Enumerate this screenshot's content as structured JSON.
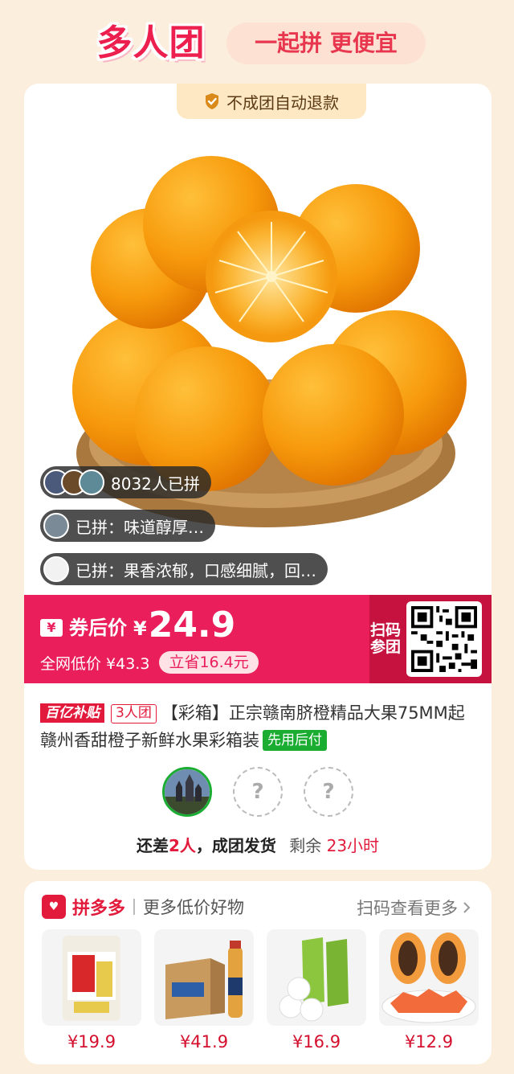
{
  "header": {
    "title": "多人团",
    "slogan": "一起拼 更便宜"
  },
  "badge": {
    "refund": "不成团自动退款"
  },
  "social": {
    "joined_count": "8032人已拼",
    "reviews": [
      "已拼：味道醇厚…",
      "已拼：果香浓郁，口感细腻，回…"
    ]
  },
  "price": {
    "coupon_label": "券后价",
    "currency": "¥",
    "value": "24.9",
    "market_label": "全网低价 ¥43.3",
    "save_label": "立省16.4元",
    "qr_label": "扫码参团"
  },
  "product": {
    "subsidy_tag": "百亿补贴",
    "group_tag": "3人团",
    "title": "【彩箱】正宗赣南脐橙精品大果75MM起赣州香甜橙子新鲜水果彩箱装",
    "pay_tag": "先用后付"
  },
  "group": {
    "empty_slot": "?",
    "status_prefix": "还差",
    "status_count": "2人",
    "status_suffix": "，成团发货",
    "remain_label": "剩余",
    "remain_time": "23小时"
  },
  "more": {
    "brand": "拼多多",
    "title": "更多低价好物",
    "scan_more": "扫码查看更多",
    "goods": [
      {
        "name": "rice-bag",
        "price": "¥19.9"
      },
      {
        "name": "tea-drink-box",
        "price": "¥41.9"
      },
      {
        "name": "tissue-rolls",
        "price": "¥16.9"
      },
      {
        "name": "papaya",
        "price": "¥12.9"
      }
    ]
  },
  "colors": {
    "accent": "#e91e5b",
    "brand_red": "#e21b3c",
    "bg": "#fbeedd",
    "green": "#1aad32"
  }
}
